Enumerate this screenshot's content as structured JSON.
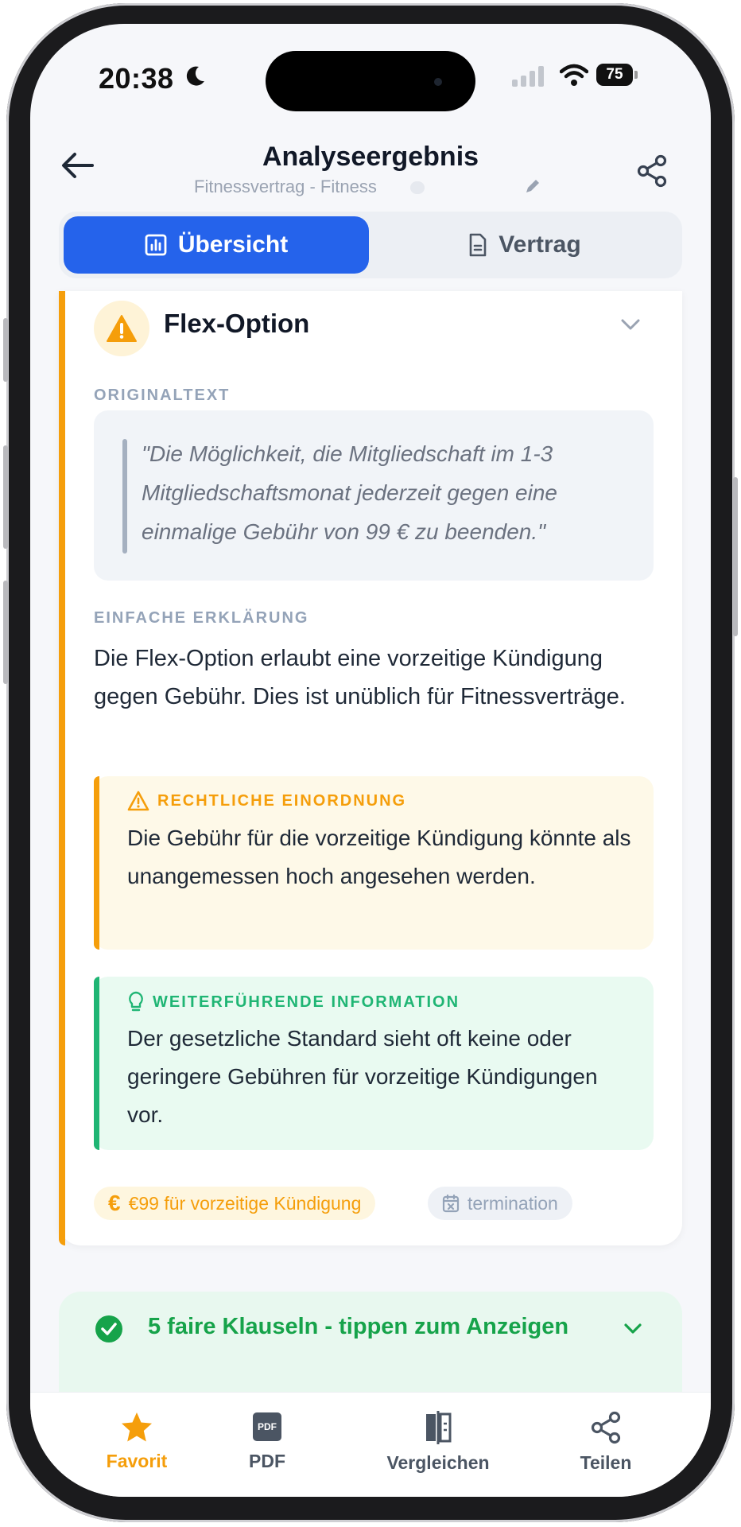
{
  "status_bar": {
    "time": "20:38",
    "battery": "75"
  },
  "header": {
    "title": "Analyseergebnis",
    "subtitle": "Fitnessvertrag - Fitness"
  },
  "tabs": [
    {
      "label": "Übersicht",
      "active": true
    },
    {
      "label": "Vertrag",
      "active": false
    }
  ],
  "clause": {
    "title": "Flex-Option",
    "original_label": "ORIGINALTEXT",
    "original_text": "\"Die Möglichkeit, die Mitgliedschaft im 1-3 Mitgliedschaftsmonat jederzeit gegen eine einmalige Gebühr von 99 € zu beenden.\"",
    "explanation_label": "EINFACHE ERKLÄRUNG",
    "explanation": "Die Flex-Option erlaubt eine vorzeitige Kündigung gegen Gebühr. Dies ist unüblich für Fitnessverträge.",
    "legal": {
      "label": "RECHTLICHE EINORDNUNG",
      "text": "Die Gebühr für die vorzeitige Kündigung könnte als unangemessen hoch angesehen werden."
    },
    "info": {
      "label": "WEITERFÜHRENDE INFORMATION",
      "text": "Der gesetzliche Standard sieht oft keine oder geringere Gebühren für vorzeitige Kündigungen vor."
    },
    "chips": {
      "fee": "€99 für vorzeitige Kündigung",
      "category": "termination"
    }
  },
  "fair_clauses": {
    "label": "5 faire Klauseln - tippen zum Anzeigen"
  },
  "bottom_nav": [
    {
      "label": "Favorit",
      "icon": "star-icon",
      "active": true
    },
    {
      "label": "PDF",
      "icon": "pdf-icon",
      "active": false
    },
    {
      "label": "Vergleichen",
      "icon": "compare-icon",
      "active": false
    },
    {
      "label": "Teilen",
      "icon": "share-icon",
      "active": false
    }
  ],
  "colors": {
    "primary": "#2563eb",
    "warning": "#f59e0b",
    "success": "#16a34a"
  }
}
